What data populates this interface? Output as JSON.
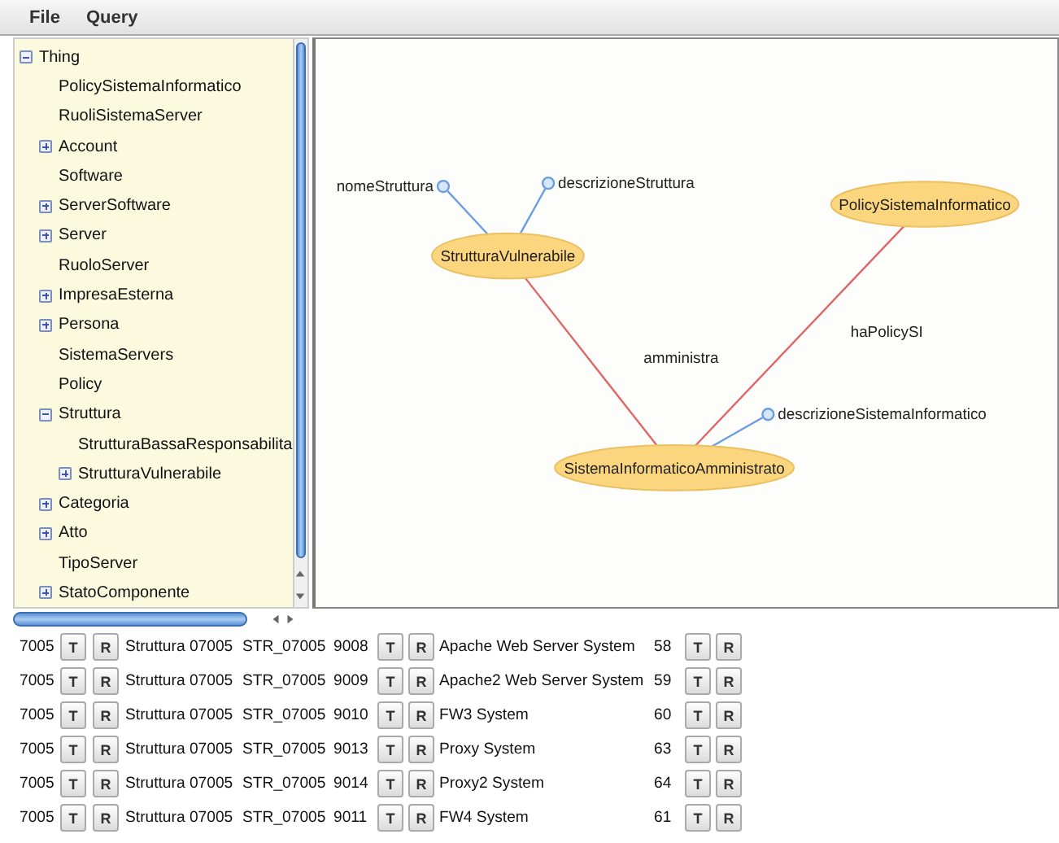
{
  "menu": [
    "File",
    "Query"
  ],
  "tree": [
    {
      "label": "Thing",
      "expanded": true,
      "children": [
        {
          "label": "PolicySistemaInformatico"
        },
        {
          "label": "RuoliSistemaServer"
        },
        {
          "label": "Account",
          "expanded": false
        },
        {
          "label": "Software"
        },
        {
          "label": "ServerSoftware",
          "expanded": false
        },
        {
          "label": "Server",
          "expanded": false
        },
        {
          "label": "RuoloServer"
        },
        {
          "label": "ImpresaEsterna",
          "expanded": false
        },
        {
          "label": "Persona",
          "expanded": false
        },
        {
          "label": "SistemaServers"
        },
        {
          "label": "Policy"
        },
        {
          "label": "Struttura",
          "expanded": true,
          "children": [
            {
              "label": "StrutturaBassaResponsabilita"
            },
            {
              "label": "StrutturaVulnerabile",
              "expanded": false
            }
          ]
        },
        {
          "label": "Categoria",
          "expanded": false
        },
        {
          "label": "Atto",
          "expanded": false
        },
        {
          "label": "TipoServer"
        },
        {
          "label": "StatoComponente",
          "expanded": false
        }
      ]
    }
  ],
  "graph": {
    "nodes": [
      {
        "label": "StrutturaVulnerabile",
        "properties": [
          "nomeStruttura",
          "descrizioneStruttura"
        ]
      },
      {
        "label": "PolicySistemaInformatico"
      },
      {
        "label": "SistemaInformaticoAmministrato",
        "properties": [
          "descrizioneSistemaInformatico"
        ]
      }
    ],
    "edges": [
      {
        "label": "amministra"
      },
      {
        "label": "haPolicySI"
      }
    ]
  },
  "rows": [
    {
      "id": "7005",
      "actions_1": [
        "T",
        "R"
      ],
      "structure": "Struttura 07005",
      "code": "STR_07005",
      "number": "9008",
      "actions_2": [
        "T",
        "R"
      ],
      "system": "Apache Web Server System",
      "count": "58",
      "actions_3": [
        "T",
        "R"
      ]
    },
    {
      "id": "7005",
      "actions_1": [
        "T",
        "R"
      ],
      "structure": "Struttura 07005",
      "code": "STR_07005",
      "number": "9009",
      "actions_2": [
        "T",
        "R"
      ],
      "system": "Apache2 Web Server System",
      "count": "59",
      "actions_3": [
        "T",
        "R"
      ]
    },
    {
      "id": "7005",
      "actions_1": [
        "T",
        "R"
      ],
      "structure": "Struttura 07005",
      "code": "STR_07005",
      "number": "9010",
      "actions_2": [
        "T",
        "R"
      ],
      "system": "FW3 System",
      "count": "60",
      "actions_3": [
        "T",
        "R"
      ]
    },
    {
      "id": "7005",
      "actions_1": [
        "T",
        "R"
      ],
      "structure": "Struttura 07005",
      "code": "STR_07005",
      "number": "9013",
      "actions_2": [
        "T",
        "R"
      ],
      "system": "Proxy System",
      "count": "63",
      "actions_3": [
        "T",
        "R"
      ]
    },
    {
      "id": "7005",
      "actions_1": [
        "T",
        "R"
      ],
      "structure": "Struttura 07005",
      "code": "STR_07005",
      "number": "9014",
      "actions_2": [
        "T",
        "R"
      ],
      "system": "Proxy2 System",
      "count": "64",
      "actions_3": [
        "T",
        "R"
      ]
    },
    {
      "id": "7005",
      "actions_1": [
        "T",
        "R"
      ],
      "structure": "Struttura 07005",
      "code": "STR_07005",
      "number": "9011",
      "actions_2": [
        "T",
        "R"
      ],
      "system": "FW4 System",
      "count": "61",
      "actions_3": [
        "T",
        "R"
      ]
    }
  ]
}
